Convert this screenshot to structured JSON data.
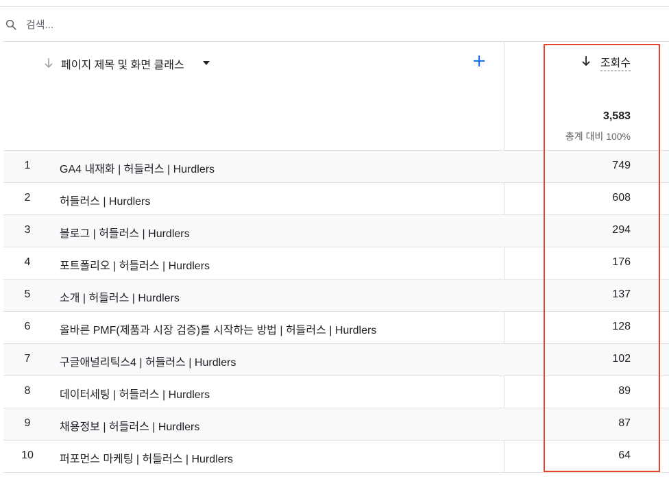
{
  "search": {
    "placeholder": "검색..."
  },
  "table": {
    "dimension_header": "페이지 제목 및 화면 클래스",
    "metric_header": "조회수",
    "total": "3,583",
    "total_pct": "총계 대비 100%",
    "rows": [
      {
        "idx": "1",
        "title": "GA4 내재화 | 허들러스 | Hurdlers",
        "value": "749"
      },
      {
        "idx": "2",
        "title": "허들러스 | Hurdlers",
        "value": "608"
      },
      {
        "idx": "3",
        "title": "블로그 | 허들러스 | Hurdlers",
        "value": "294"
      },
      {
        "idx": "4",
        "title": "포트폴리오 | 허들러스 | Hurdlers",
        "value": "176"
      },
      {
        "idx": "5",
        "title": "소개 | 허들러스 | Hurdlers",
        "value": "137"
      },
      {
        "idx": "6",
        "title": "올바른 PMF(제품과 시장 검증)를 시작하는 방법 | 허들러스 | Hurdlers",
        "value": "128"
      },
      {
        "idx": "7",
        "title": "구글애널리틱스4 | 허들러스 | Hurdlers",
        "value": "102"
      },
      {
        "idx": "8",
        "title": "데이터세팅 | 허들러스 | Hurdlers",
        "value": "89"
      },
      {
        "idx": "9",
        "title": "채용정보 | 허들러스 | Hurdlers",
        "value": "87"
      },
      {
        "idx": "10",
        "title": "퍼포먼스 마케팅 | 허들러스 | Hurdlers",
        "value": "64"
      }
    ]
  },
  "colors": {
    "highlight": "#e8412c",
    "accent": "#1a73e8"
  }
}
